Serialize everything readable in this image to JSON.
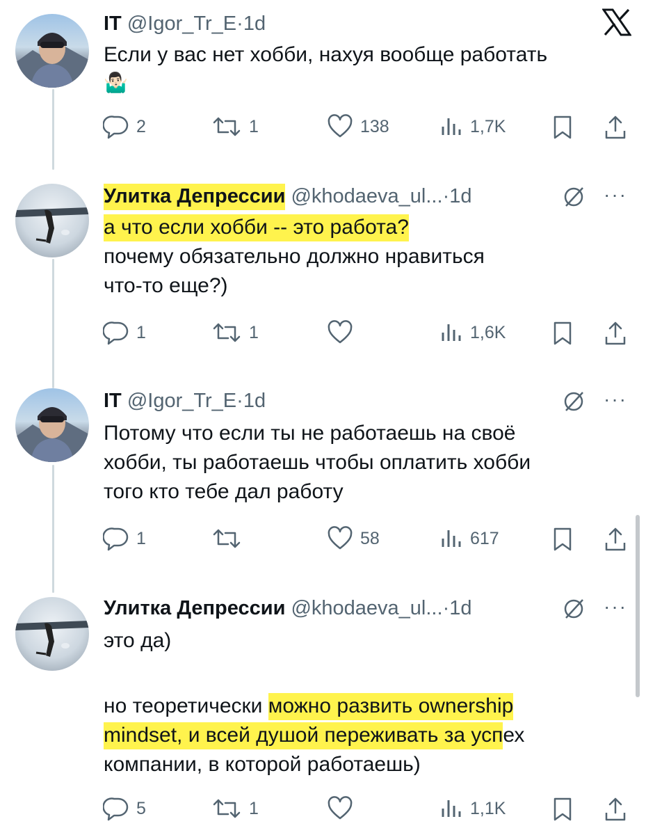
{
  "app": {
    "logo": "x-logo-icon"
  },
  "tweets": [
    {
      "name": "IT",
      "handle": "@Igor_Tr_E",
      "sep": "·",
      "time": "1d",
      "lines": [
        "Если у вас нет хобби, нахуя вообще работать"
      ],
      "emoji": "🤷🏻‍♂️",
      "replies": "2",
      "reposts": "1",
      "likes": "138",
      "views": "1,7K"
    },
    {
      "name": "Улитка Депрессии",
      "handle": "@khodaeva_ul...",
      "sep": "·",
      "time": "1d",
      "lines": [
        "а что если хобби -- это работа?",
        "почему обязательно должно нравиться",
        "что-то еще?)"
      ],
      "replies": "1",
      "reposts": "1",
      "likes": "",
      "views": "1,6K"
    },
    {
      "name": "IT",
      "handle": "@Igor_Tr_E",
      "sep": "·",
      "time": "1d",
      "lines": [
        "Потому что если ты не работаешь на своё",
        "хобби, ты работаешь чтобы оплатить хобби",
        "того кто тебе дал работу"
      ],
      "replies": "1",
      "reposts": "",
      "likes": "58",
      "views": "617"
    },
    {
      "name": "Улитка Депрессии",
      "handle": "@khodaeva_ul...",
      "sep": "·",
      "time": "1d",
      "line1": "это да)",
      "line2a": "но теоретически ",
      "line2b": "можно развить ownership",
      "line3a": "mindset, и всей душой переживать за усп",
      "line3b": "ех",
      "line4": "компании, в которой работаешь)",
      "replies": "5",
      "reposts": "1",
      "likes": "",
      "views": "1,1K"
    }
  ],
  "highlight_color": "#fff34d"
}
